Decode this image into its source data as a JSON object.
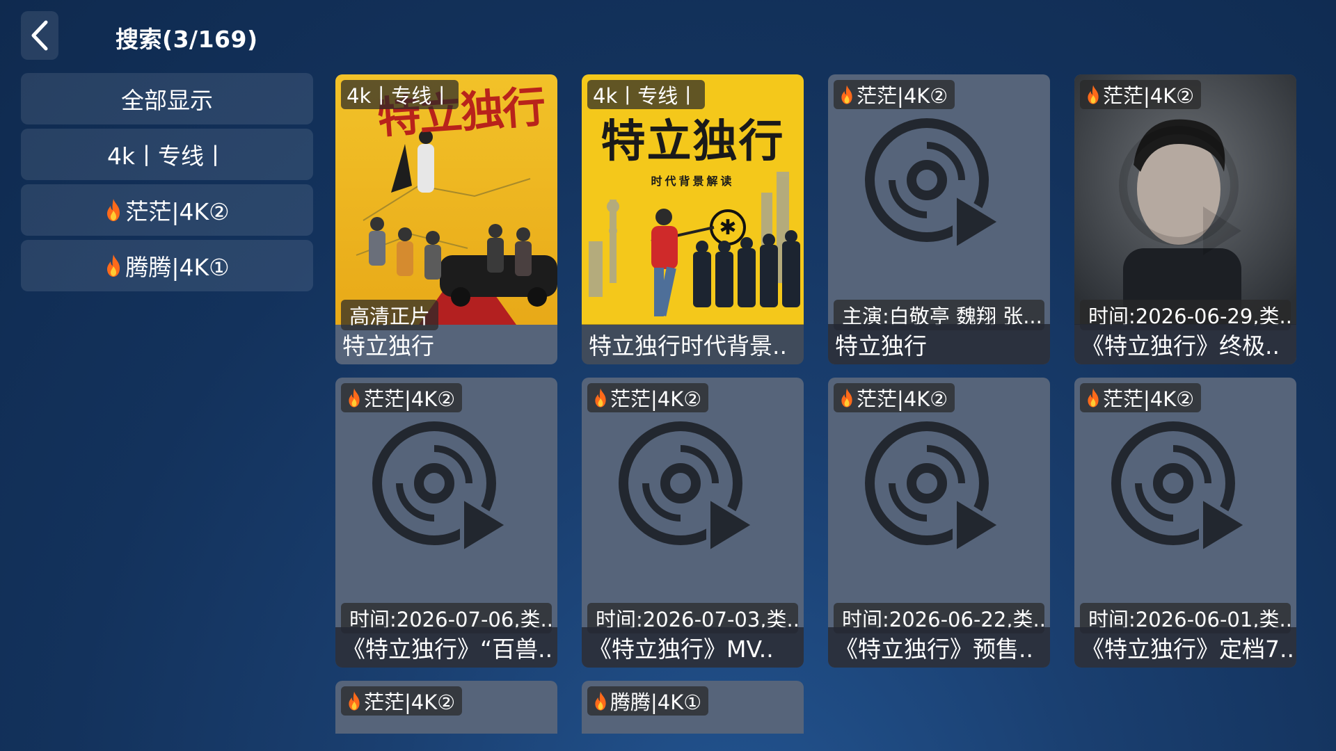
{
  "header": {
    "title": "搜索(3/169)"
  },
  "sidebar": {
    "items": [
      {
        "label": "全部显示",
        "fire": false
      },
      {
        "label": "4k丨专线丨",
        "fire": true
      },
      {
        "label": "茫茫|4K②",
        "fire": true
      },
      {
        "label": "腾腾|4K①",
        "fire": true
      }
    ]
  },
  "cards": [
    {
      "tag": "4k丨专线丨",
      "sub": "高清正片",
      "name": "特立独行",
      "poster": "title-poster-red",
      "poster_title": "特立独行"
    },
    {
      "tag": "4k丨专线丨",
      "sub": "",
      "name": "特立独行时代背景..",
      "poster": "yellow-poster",
      "poster_title": "特立独行",
      "poster_subtitle": "时代背景解读"
    },
    {
      "tag": "茫茫|4K②",
      "sub": "主演:白敬亭 魏翔 张...",
      "name": "特立独行",
      "poster": "placeholder"
    },
    {
      "tag": "茫茫|4K②",
      "sub": "时间:2026-06-29,类...",
      "name": "《特立独行》终极..",
      "poster": "portrait"
    },
    {
      "tag": "茫茫|4K②",
      "sub": "时间:2026-07-06,类...",
      "name": "《特立独行》“百兽..",
      "poster": "placeholder"
    },
    {
      "tag": "茫茫|4K②",
      "sub": "时间:2026-07-03,类...",
      "name": "《特立独行》MV..",
      "poster": "placeholder"
    },
    {
      "tag": "茫茫|4K②",
      "sub": "时间:2026-06-22,类...",
      "name": "《特立独行》预售..",
      "poster": "placeholder"
    },
    {
      "tag": "茫茫|4K②",
      "sub": "时间:2026-06-01,类...",
      "name": "《特立独行》定档7..",
      "poster": "placeholder"
    },
    {
      "tag": "茫茫|4K②",
      "partial": true
    },
    {
      "tag": "腾腾|4K①",
      "partial": true
    }
  ],
  "colors": {
    "fire": "#ff6a1a",
    "placeholder_bg": "#56647a",
    "disc": "#1f2329"
  }
}
